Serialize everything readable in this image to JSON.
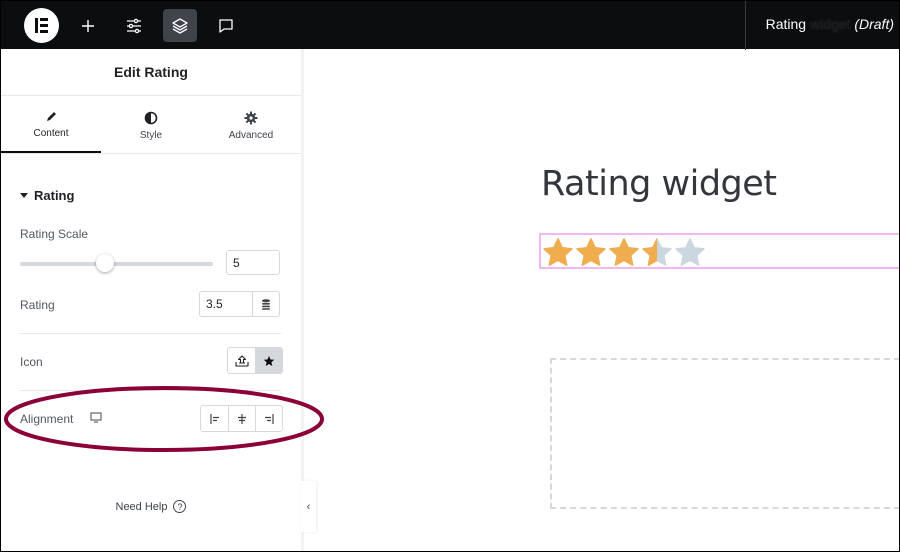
{
  "topbar": {
    "logo": "elementor-logo",
    "buttons": [
      {
        "name": "add-element",
        "icon": "plus-icon"
      },
      {
        "name": "site-settings",
        "icon": "sliders-icon"
      },
      {
        "name": "structure",
        "icon": "layers-icon",
        "active": true
      },
      {
        "name": "comments",
        "icon": "comment-icon"
      }
    ],
    "title_main": "Rating",
    "title_dim": " widget",
    "title_status": "(Draft)"
  },
  "panel": {
    "header": "Edit Rating",
    "tabs": [
      {
        "label": "Content",
        "icon": "pencil-icon",
        "active": true
      },
      {
        "label": "Style",
        "icon": "contrast-icon",
        "active": false
      },
      {
        "label": "Advanced",
        "icon": "gear-icon",
        "active": false
      }
    ],
    "section": "Rating",
    "controls": {
      "rating_scale_label": "Rating Scale",
      "rating_scale_value": "5",
      "rating_scale_slider_fraction": 0.4,
      "rating_label": "Rating",
      "rating_value": "3.5",
      "icon_label": "Icon",
      "icon_options": [
        "upload-icon",
        "star-icon"
      ],
      "icon_selected": "star-icon",
      "alignment_label": "Alignment",
      "alignment_device": "desktop-icon",
      "alignment_options": [
        "align-start-icon",
        "align-center-icon",
        "align-end-icon"
      ]
    },
    "need_help": "Need Help",
    "collapse": "‹"
  },
  "canvas": {
    "heading": "Rating widget",
    "rating": {
      "value": 3.5,
      "scale": 5,
      "filled_color": "#f0ad4e",
      "empty_color": "#ccd6df"
    }
  },
  "annotation_color": "#8b0038"
}
